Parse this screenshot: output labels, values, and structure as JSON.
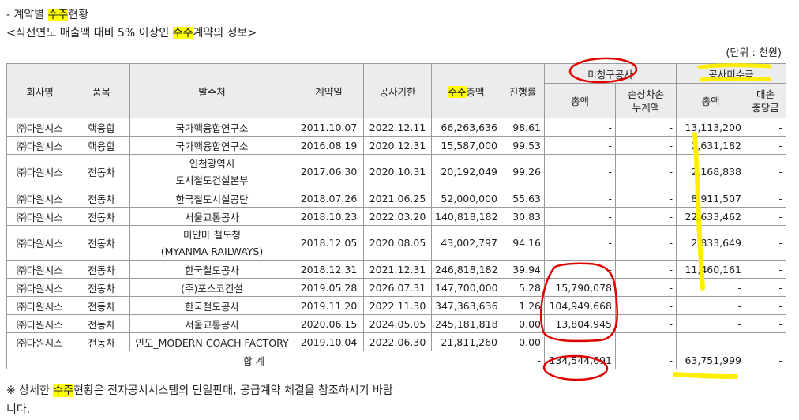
{
  "title": {
    "prefix": "- 계약별 ",
    "hl": "수주",
    "suffix": "현황"
  },
  "subtitle": {
    "prefix": "<직전연도 매출액 대비 5% 이상인 ",
    "hl": "수주",
    "suffix": "계약의 정보>"
  },
  "unit": "(단위 : 천원)",
  "headers": {
    "company": "회사명",
    "item": "품목",
    "client": "발주처",
    "contract_date": "계약일",
    "period": "공사기한",
    "total_hl": "수주",
    "total_rest": "총액",
    "progress": "진행률",
    "unbilled": "미청구공사",
    "unbilled_total": "총액",
    "unbilled_loss": [
      "손상차손",
      "누계액"
    ],
    "receivable": "공사미수금",
    "receivable_total": "총액",
    "receivable_allow": [
      "대손",
      "충당금"
    ]
  },
  "rows": [
    {
      "company": "㈜다원시스",
      "item": "핵융합",
      "client": [
        "국가핵융합연구소"
      ],
      "date": "2011.10.07",
      "period": "2022.12.11",
      "total": "66,263,636",
      "progress": "98.61",
      "unbilled": "-",
      "loss": "-",
      "receivable": "13,113,200",
      "allow": "-"
    },
    {
      "company": "㈜다원시스",
      "item": "핵융합",
      "client": [
        "국가핵융합연구소"
      ],
      "date": "2016.08.19",
      "period": "2020.12.31",
      "total": "15,587,000",
      "progress": "99.53",
      "unbilled": "-",
      "loss": "-",
      "receivable": "2,631,182",
      "allow": "-"
    },
    {
      "company": "㈜다원시스",
      "item": "전동차",
      "client": [
        "인천광역시",
        "도시철도건설본부"
      ],
      "date": "2017.06.30",
      "period": "2020.10.31",
      "total": "20,192,049",
      "progress": "99.26",
      "unbilled": "-",
      "loss": "-",
      "receivable": "2,168,838",
      "allow": "-"
    },
    {
      "company": "㈜다원시스",
      "item": "전동차",
      "client": [
        "한국철도시설공단"
      ],
      "date": "2018.07.26",
      "period": "2021.06.25",
      "total": "52,000,000",
      "progress": "55.63",
      "unbilled": "-",
      "loss": "-",
      "receivable": "8,911,507",
      "allow": "-"
    },
    {
      "company": "㈜다원시스",
      "item": "전동차",
      "client": [
        "서울교통공사"
      ],
      "date": "2018.10.23",
      "period": "2022.03.20",
      "total": "140,818,182",
      "progress": "30.83",
      "unbilled": "-",
      "loss": "-",
      "receivable": "22,633,462",
      "allow": "-"
    },
    {
      "company": "㈜다원시스",
      "item": "전동차",
      "client": [
        "미얀마 철도청",
        "(MYANMA RAILWAYS)"
      ],
      "date": "2018.12.05",
      "period": "2020.08.05",
      "total": "43,002,797",
      "progress": "94.16",
      "unbilled": "-",
      "loss": "-",
      "receivable": "2,833,649",
      "allow": "-"
    },
    {
      "company": "㈜다원시스",
      "item": "전동차",
      "client": [
        "한국철도공사"
      ],
      "date": "2018.12.31",
      "period": "2021.12.31",
      "total": "246,818,182",
      "progress": "39.94",
      "unbilled": "-",
      "loss": "-",
      "receivable": "11,460,161",
      "allow": "-"
    },
    {
      "company": "㈜다원시스",
      "item": "전동차",
      "client": [
        "(주)포스코건설"
      ],
      "date": "2019.05.28",
      "period": "2026.07.31",
      "total": "147,700,000",
      "progress": "5.28",
      "unbilled": "15,790,078",
      "loss": "-",
      "receivable": "-",
      "allow": "-"
    },
    {
      "company": "㈜다원시스",
      "item": "전동차",
      "client": [
        "한국철도공사"
      ],
      "date": "2019.11.20",
      "period": "2022.11.30",
      "total": "347,363,636",
      "progress": "1.26",
      "unbilled": "104,949,668",
      "loss": "-",
      "receivable": "-",
      "allow": "-"
    },
    {
      "company": "㈜다원시스",
      "item": "전동차",
      "client": [
        "서울교통공사"
      ],
      "date": "2020.06.15",
      "period": "2024.05.05",
      "total": "245,181,818",
      "progress": "0.00",
      "unbilled": "13,804,945",
      "loss": "-",
      "receivable": "-",
      "allow": "-"
    },
    {
      "company": "㈜다원시스",
      "item": "전동차",
      "client": [
        "인도_MODERN COACH FACTORY"
      ],
      "date": "2019.10.04",
      "period": "2022.06.30",
      "total": "21,811,260",
      "progress": "0.00",
      "unbilled": "-",
      "loss": "-",
      "receivable": "-",
      "allow": "-"
    }
  ],
  "sum_row": {
    "label": "합 계",
    "progress": "-",
    "unbilled": "134,544,691",
    "loss": "-",
    "receivable": "63,751,999",
    "allow": "-"
  },
  "note": {
    "prefix": "※ 상세한 ",
    "hl": "수주",
    "suffix": "현황은 전자공시시스템의 단일판매, 공급계약 체결을 참조하시기 바람",
    "line2": "니다."
  },
  "colors": {
    "highlight": "#ffff00",
    "red_markup": "#e00000",
    "yellow_markup": "#ffee00"
  }
}
